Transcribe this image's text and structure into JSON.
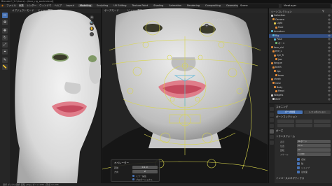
{
  "window": {
    "title": "Blender* [C:\\Users\\...\\face_rig_work.blend]"
  },
  "menubar": {
    "items": [
      "ファイル",
      "編集",
      "レンダー",
      "ウィンドウ",
      "ヘルプ"
    ],
    "workspaces": [
      "Layout",
      "Modeling",
      "Sculpting",
      "UV Editing",
      "Texture Paint",
      "Shading",
      "Animation",
      "Rendering",
      "Compositing",
      "Geometry Nodes",
      "Scripting"
    ],
    "active_workspace": "Modeling",
    "scene": "Scene",
    "view_layer": "ViewLayer"
  },
  "toolbar": {
    "tools": [
      "select",
      "cursor",
      "move",
      "rotate",
      "scale",
      "transform",
      "annotate",
      "measure"
    ],
    "icons": [
      "select-box-icon",
      "cursor-icon",
      "move-icon",
      "rotate-icon",
      "scale-icon",
      "transform-icon",
      "annotate-icon",
      "measure-icon"
    ]
  },
  "viewport_left": {
    "header_items": [
      "オブジェクトモード",
      "ビュー",
      "選択",
      "追加"
    ]
  },
  "viewport_right": {
    "header_items": [
      "ポーズモード",
      "ビュー",
      "選択",
      "ポーズ"
    ],
    "overlay_label": "ポーズライブラリ"
  },
  "outliner": {
    "header": "シーンコレクション",
    "rows": [
      {
        "label": "Collection",
        "color": "#cfcfcf",
        "selected": false
      },
      {
        "label": "Camera",
        "color": "#d68a3a",
        "selected": false
      },
      {
        "label": "Light",
        "color": "#e2c94b",
        "selected": false
      },
      {
        "label": "Face",
        "color": "#e28a3a",
        "selected": false
      },
      {
        "label": "Armature",
        "color": "#58b5d6",
        "selected": false
      },
      {
        "label": "Rig",
        "color": "#58b5d6",
        "selected": true
      },
      {
        "label": "Pose",
        "color": "#58b5d6",
        "selected": false
      },
      {
        "label": "ボーン",
        "color": "#6fb86f",
        "selected": false
      },
      {
        "label": "face_ctrl",
        "color": "#e28a3a",
        "selected": false
      },
      {
        "label": "eye_L",
        "color": "#e28a3a",
        "selected": false
      },
      {
        "label": "eye_R",
        "color": "#e28a3a",
        "selected": false
      },
      {
        "label": "jaw",
        "color": "#e28a3a",
        "selected": false
      },
      {
        "label": "tongue",
        "color": "#e28a3a",
        "selected": false
      },
      {
        "label": "teeth",
        "color": "#e28a3a",
        "selected": false
      },
      {
        "label": "lips",
        "color": "#e28a3a",
        "selected": false
      },
      {
        "label": "brow",
        "color": "#e28a3a",
        "selected": false
      },
      {
        "label": "cheek",
        "color": "#e28a3a",
        "selected": false
      },
      {
        "label": "nose",
        "color": "#e28a3a",
        "selected": false
      },
      {
        "label": "Body",
        "color": "#e28a3a",
        "selected": false
      },
      {
        "label": "Head",
        "color": "#e28a3a",
        "selected": false
      },
      {
        "label": "Widgets",
        "color": "#cfcfcf",
        "selected": false
      },
      {
        "label": "WGT",
        "color": "#cfcfcf",
        "selected": false
      }
    ]
  },
  "properties": {
    "panel1": "スキニング",
    "panel2": "ボーンコレクション",
    "panel3": "ポーズ",
    "panel4": "トランスフォーム",
    "buttons_row1": [
      "ポーズ位置",
      "レストポジション"
    ],
    "field_labels": [
      "表示",
      "位置",
      "回転",
      "スケール"
    ],
    "field_values": [
      "B-ボーン",
      "0 m",
      "0°",
      "1.000"
    ],
    "checkbox_labels": [
      "名前",
      "軸",
      "シェイプ",
      "最前面"
    ],
    "footer": "インバースキネマティクス"
  },
  "operator_panel": {
    "title": "オペレーター",
    "labels": [
      "距離",
      "方向",
      "ローカル"
    ],
    "values": [
      "0.1 m",
      "Z"
    ],
    "checkbox_labels": [
      "ミラー編集",
      "プロポーショナル"
    ]
  },
  "statusbar": {
    "text": "選択   ボックス選択   回転   |   Rig | ボーン:1/84 | 頂点:12,408"
  },
  "colors": {
    "accent": "#4772b3",
    "bone_line": "#d9d64c",
    "bone_selected": "#58b5d6",
    "skin": "#e8e8e8",
    "mouth": "#e07d8a"
  }
}
